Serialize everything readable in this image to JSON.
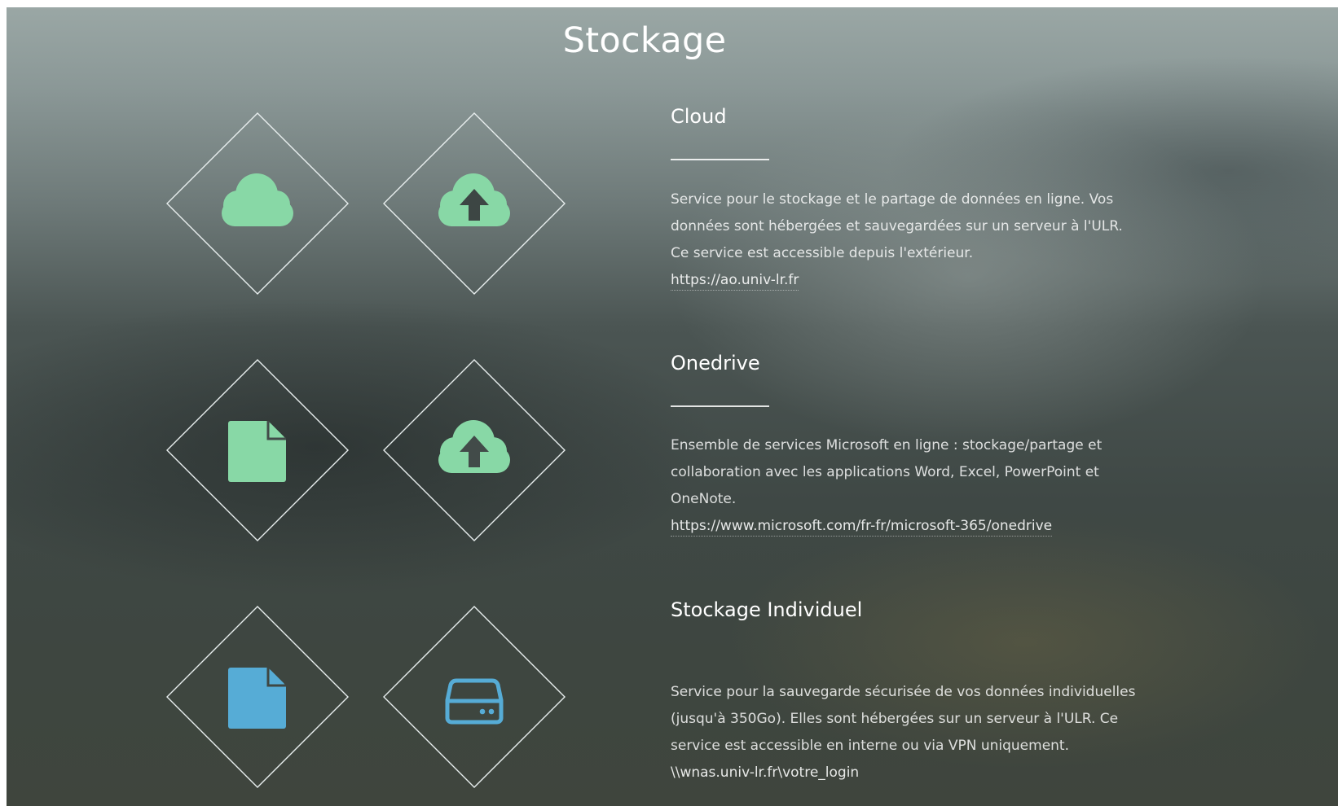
{
  "page": {
    "title": "Stockage"
  },
  "colors": {
    "green_icon": "#88d8a6",
    "blue_icon": "#56acd6",
    "diamond_stroke": "#e8eeee"
  },
  "sections": [
    {
      "title": "Cloud",
      "description": "Service pour le stockage et le partage de données en ligne. Vos données sont hébergées et sauvegardées sur un serveur à l'ULR. Ce service est accessible depuis l'extérieur.",
      "link": "https://ao.univ-lr.fr",
      "icons": [
        "cloud-icon",
        "cloud-upload-icon"
      ]
    },
    {
      "title": "Onedrive",
      "description": "Ensemble de services Microsoft en ligne : stockage/partage et collaboration avec les applications Word, Excel, PowerPoint et OneNote.",
      "link": "https://www.microsoft.com/fr-fr/microsoft-365/onedrive",
      "icons": [
        "file-icon",
        "cloud-upload-icon"
      ]
    },
    {
      "title": "Stockage Individuel",
      "description": "Service pour la sauvegarde sécurisée de vos données individuelles (jusqu'à 350Go). Elles sont hébergées sur un serveur à l'ULR. Ce service est accessible en interne ou via VPN uniquement.",
      "link": "\\\\wnas.univ-lr.fr\\votre_login",
      "icons": [
        "file-icon",
        "hard-drive-icon"
      ]
    }
  ]
}
